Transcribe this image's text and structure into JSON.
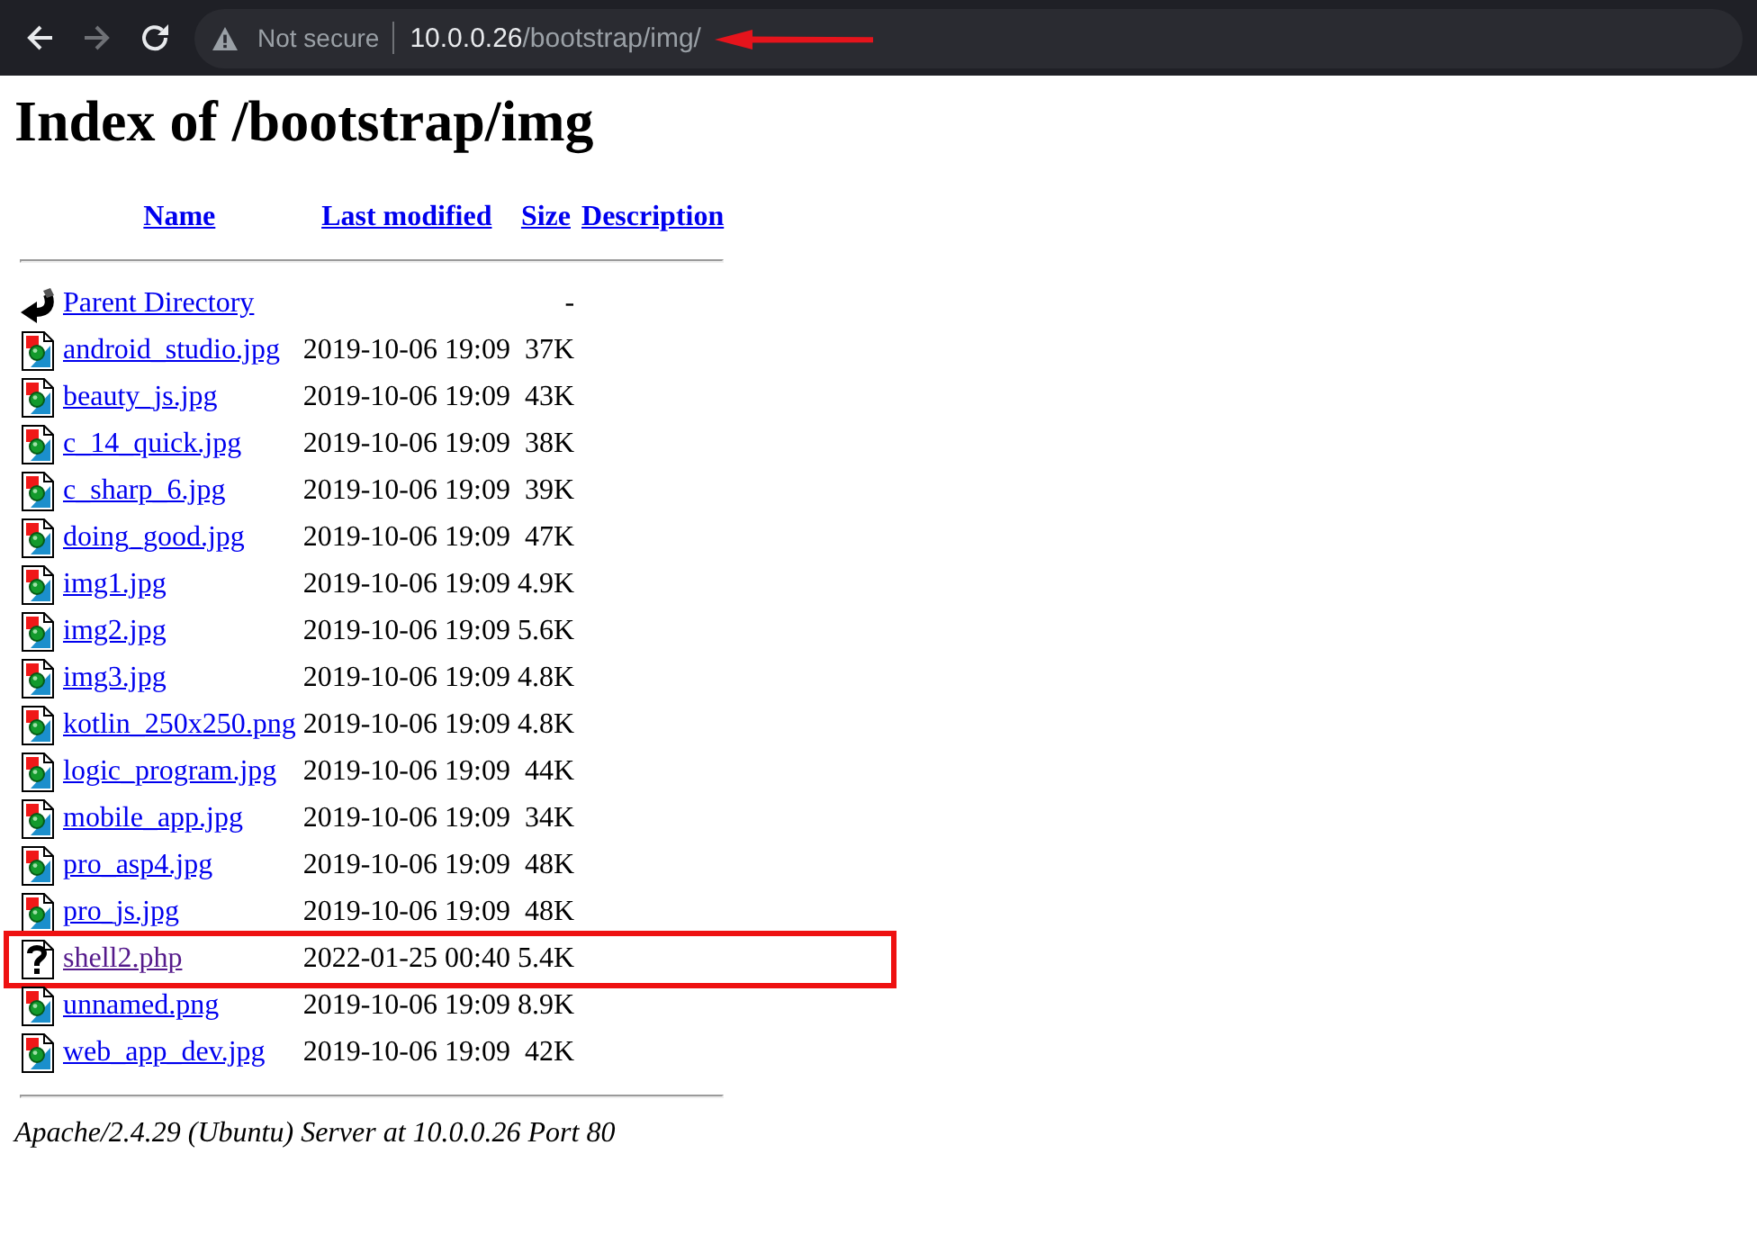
{
  "toolbar": {
    "buttons": [
      {
        "kind": "back",
        "disabled": false
      },
      {
        "kind": "forward",
        "disabled": true
      },
      {
        "kind": "reload",
        "disabled": false
      }
    ],
    "address_bar": {
      "security_label": "Not secure",
      "host": "10.0.0.26",
      "path": "/bootstrap/img/",
      "annotation_arrow": true
    }
  },
  "page": {
    "title": "Index of /bootstrap/img",
    "columns": [
      "Name",
      "Last modified",
      "Size",
      "Description"
    ],
    "files": [
      {
        "kind": "parent",
        "name": "Parent Directory",
        "size": "-",
        "visited": false,
        "highlighted": false
      },
      {
        "kind": "image",
        "name": "android_studio.jpg",
        "modified": "2019-10-06 19:09",
        "size": "37K",
        "visited": false,
        "highlighted": false
      },
      {
        "kind": "image",
        "name": "beauty_js.jpg",
        "modified": "2019-10-06 19:09",
        "size": "43K",
        "visited": false,
        "highlighted": false
      },
      {
        "kind": "image",
        "name": "c_14_quick.jpg",
        "modified": "2019-10-06 19:09",
        "size": "38K",
        "visited": false,
        "highlighted": false
      },
      {
        "kind": "image",
        "name": "c_sharp_6.jpg",
        "modified": "2019-10-06 19:09",
        "size": "39K",
        "visited": false,
        "highlighted": false
      },
      {
        "kind": "image",
        "name": "doing_good.jpg",
        "modified": "2019-10-06 19:09",
        "size": "47K",
        "visited": false,
        "highlighted": false
      },
      {
        "kind": "image",
        "name": "img1.jpg",
        "modified": "2019-10-06 19:09",
        "size": "4.9K",
        "visited": false,
        "highlighted": false
      },
      {
        "kind": "image",
        "name": "img2.jpg",
        "modified": "2019-10-06 19:09",
        "size": "5.6K",
        "visited": false,
        "highlighted": false
      },
      {
        "kind": "image",
        "name": "img3.jpg",
        "modified": "2019-10-06 19:09",
        "size": "4.8K",
        "visited": false,
        "highlighted": false
      },
      {
        "kind": "image",
        "name": "kotlin_250x250.png",
        "modified": "2019-10-06 19:09",
        "size": "4.8K",
        "visited": false,
        "highlighted": false
      },
      {
        "kind": "image",
        "name": "logic_program.jpg",
        "modified": "2019-10-06 19:09",
        "size": "44K",
        "visited": false,
        "highlighted": false
      },
      {
        "kind": "image",
        "name": "mobile_app.jpg",
        "modified": "2019-10-06 19:09",
        "size": "34K",
        "visited": false,
        "highlighted": false
      },
      {
        "kind": "image",
        "name": "pro_asp4.jpg",
        "modified": "2019-10-06 19:09",
        "size": "48K",
        "visited": false,
        "highlighted": false
      },
      {
        "kind": "image",
        "name": "pro_js.jpg",
        "modified": "2019-10-06 19:09",
        "size": "48K",
        "visited": false,
        "highlighted": false
      },
      {
        "kind": "unknown",
        "name": "shell2.php",
        "modified": "2022-01-25 00:40",
        "size": "5.4K",
        "visited": true,
        "highlighted": true
      },
      {
        "kind": "image",
        "name": "unnamed.png",
        "modified": "2019-10-06 19:09",
        "size": "8.9K",
        "visited": false,
        "highlighted": false
      },
      {
        "kind": "image",
        "name": "web_app_dev.jpg",
        "modified": "2019-10-06 19:09",
        "size": "42K",
        "visited": false,
        "highlighted": false
      }
    ],
    "footer": "Apache/2.4.29 (Ubuntu) Server at 10.0.0.26 Port 80"
  }
}
